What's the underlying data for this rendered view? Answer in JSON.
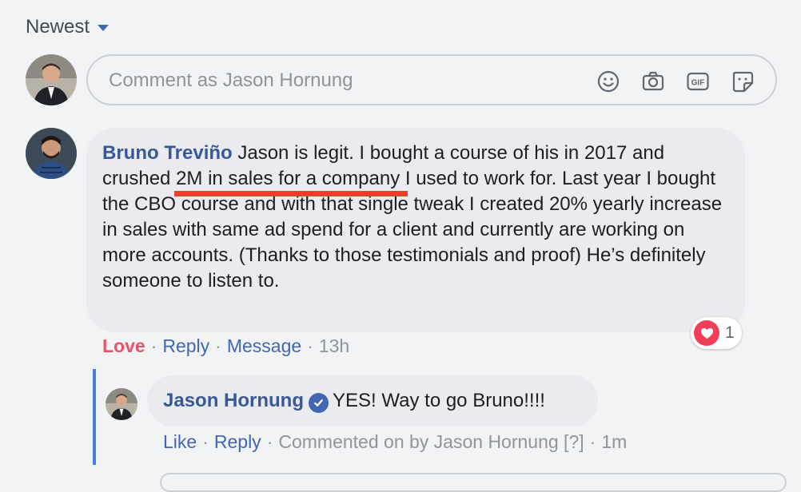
{
  "sort": {
    "label": "Newest"
  },
  "composer": {
    "placeholder": "Comment as Jason Hornung",
    "icons": [
      "emoji-icon",
      "camera-icon",
      "gif-icon",
      "sticker-icon"
    ]
  },
  "comment": {
    "author": "Bruno Treviño",
    "text_before": " Jason is legit. I bought a course of his in 2017 and crushed ",
    "highlight": "2M in sales for a company",
    "text_after": " I used to work for. Last year I bought the CBO course and with that single tweak I created 20% yearly increase in sales with same ad spend for a client and currently are working on more accounts. (Thanks to those testimonials and proof) He’s definitely someone to listen to.",
    "actions": {
      "love": "Love",
      "reply": "Reply",
      "message": "Message",
      "time": "13h"
    },
    "reaction": {
      "icon": "heart-icon",
      "count": "1"
    }
  },
  "reply": {
    "author": "Jason Hornung",
    "text": "YES! Way to go Bruno!!!!",
    "actions": {
      "like": "Like",
      "reply": "Reply",
      "commented_on": "Commented on by Jason Hornung [?]",
      "time": "1m"
    }
  },
  "colors": {
    "link": "#385898",
    "love": "#e9546b",
    "highlight": "#e8412a",
    "bubble": "#e9ebee",
    "thread": "#4c7cdc"
  }
}
